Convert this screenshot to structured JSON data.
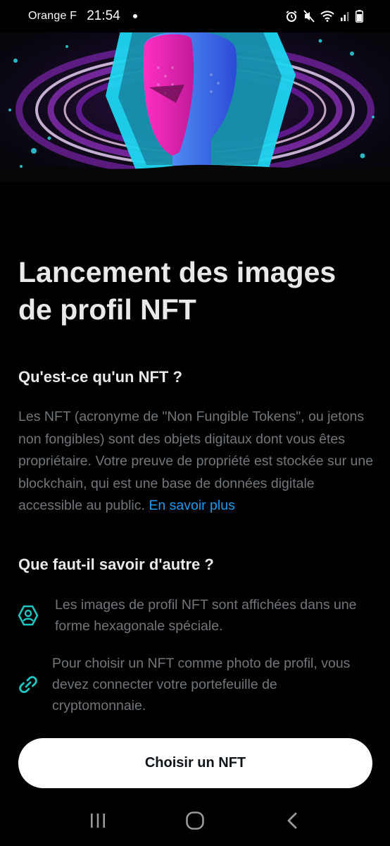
{
  "status_bar": {
    "carrier": "Orange F",
    "time": "21:54"
  },
  "page": {
    "title": "Lancement des images de profil NFT",
    "section1_heading": "Qu'est-ce qu'un NFT ?",
    "section1_body": "Les NFT (acronyme de \"Non Fungible Tokens\", ou jetons non fongibles) sont des objets digitaux dont vous êtes propriétaire. Votre preuve de propriété est stockée sur une blockchain, qui est une base de données digitale accessible au public.",
    "learn_more_link": "En savoir plus",
    "section2_heading": "Que faut-il savoir d'autre ?",
    "features": [
      {
        "icon": "hexagon-profile-icon",
        "text": "Les images de profil NFT sont affichées dans une forme hexagonale spéciale."
      },
      {
        "icon": "link-icon",
        "text": "Pour choisir un NFT comme photo de profil, vous devez connecter votre portefeuille de cryptomonnaie."
      }
    ],
    "cta_label": "Choisir un NFT"
  },
  "colors": {
    "background": "#000000",
    "heading": "#e7e9ea",
    "body_text": "#71767b",
    "link": "#1d9bf0",
    "icon_teal": "#1cc6c2",
    "button_bg": "#ffffff"
  }
}
